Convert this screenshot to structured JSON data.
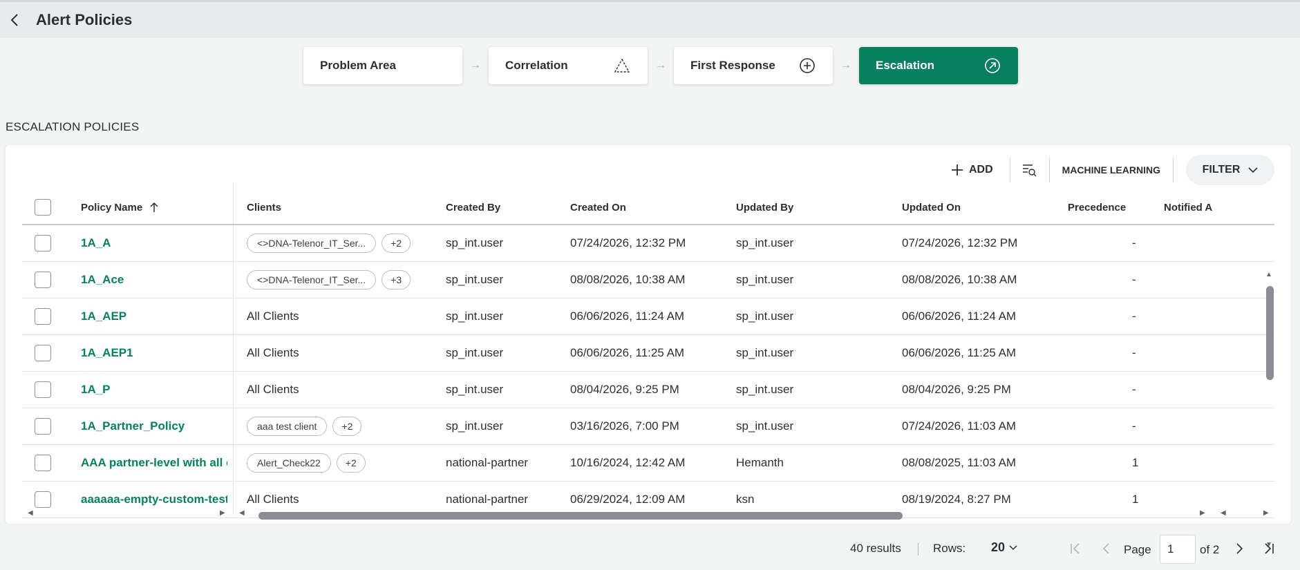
{
  "header": {
    "title": "Alert Policies"
  },
  "steps": [
    {
      "label": "Problem Area",
      "icon": "none"
    },
    {
      "label": "Correlation",
      "icon": "triangle-dashed-icon"
    },
    {
      "label": "First Response",
      "icon": "plus-circle-icon"
    },
    {
      "label": "Escalation",
      "icon": "arrow-up-right-circle-icon"
    }
  ],
  "section_title": "ESCALATION POLICIES",
  "toolbar": {
    "add_label": "ADD",
    "ml_label": "MACHINE LEARNING",
    "filter_label": "FILTER"
  },
  "columns": {
    "policy_name": "Policy Name",
    "clients": "Clients",
    "created_by": "Created By",
    "created_on": "Created On",
    "updated_by": "Updated By",
    "updated_on": "Updated On",
    "precedence": "Precedence",
    "notified": "Notified A"
  },
  "rows": [
    {
      "name": "1A_A",
      "client_chip": "<>DNA-Telenor_IT_Ser...",
      "client_more": "+2",
      "client_text": "",
      "created_by": "sp_int.user",
      "created_on": "07/24/2026, 12:32 PM",
      "updated_by": "sp_int.user",
      "updated_on": "07/24/2026, 12:32 PM",
      "precedence": "-"
    },
    {
      "name": "1A_Ace",
      "client_chip": "<>DNA-Telenor_IT_Ser...",
      "client_more": "+3",
      "client_text": "",
      "created_by": "sp_int.user",
      "created_on": "08/08/2026, 10:38 AM",
      "updated_by": "sp_int.user",
      "updated_on": "08/08/2026, 10:38 AM",
      "precedence": "-"
    },
    {
      "name": "1A_AEP",
      "client_chip": "",
      "client_more": "",
      "client_text": "All Clients",
      "created_by": "sp_int.user",
      "created_on": "06/06/2026, 11:24 AM",
      "updated_by": "sp_int.user",
      "updated_on": "06/06/2026, 11:24 AM",
      "precedence": "-"
    },
    {
      "name": "1A_AEP1",
      "client_chip": "",
      "client_more": "",
      "client_text": "All Clients",
      "created_by": "sp_int.user",
      "created_on": "06/06/2026, 11:25 AM",
      "updated_by": "sp_int.user",
      "updated_on": "06/06/2026, 11:25 AM",
      "precedence": "-"
    },
    {
      "name": "1A_P",
      "client_chip": "",
      "client_more": "",
      "client_text": "All Clients",
      "created_by": "sp_int.user",
      "created_on": "08/04/2026, 9:25 PM",
      "updated_by": "sp_int.user",
      "updated_on": "08/04/2026, 9:25 PM",
      "precedence": "-"
    },
    {
      "name": "1A_Partner_Policy",
      "client_chip": "aaa test client",
      "client_more": "+2",
      "client_text": "",
      "created_by": "sp_int.user",
      "created_on": "03/16/2026, 7:00 PM",
      "updated_by": "sp_int.user",
      "updated_on": "07/24/2026, 11:03 AM",
      "precedence": "-"
    },
    {
      "name": "AAA partner-level with all cl",
      "client_chip": "Alert_Check22",
      "client_more": "+2",
      "client_text": "",
      "created_by": "national-partner",
      "created_on": "10/16/2024, 12:42 AM",
      "updated_by": "Hemanth",
      "updated_on": "08/08/2025, 11:03 AM",
      "precedence": "1"
    },
    {
      "name": "aaaaaa-empty-custom-test.",
      "client_chip": "",
      "client_more": "",
      "client_text": "All Clients",
      "created_by": "national-partner",
      "created_on": "06/29/2024, 12:09 AM",
      "updated_by": "ksn",
      "updated_on": "08/19/2024, 8:27 PM",
      "precedence": "1"
    }
  ],
  "pagination": {
    "results": "40 results",
    "rows_label": "Rows:",
    "rows_value": "20",
    "page_label": "Page",
    "page_value": "1",
    "of_label": "of 2"
  },
  "colors": {
    "accent": "#087f5f",
    "text": "#2b2f33"
  }
}
